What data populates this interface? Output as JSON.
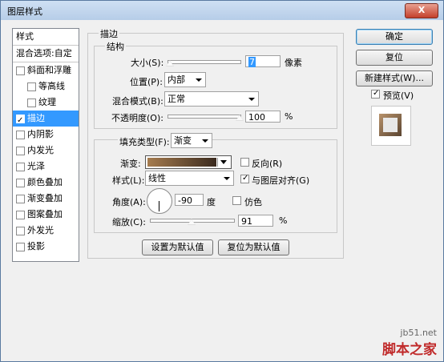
{
  "window": {
    "title": "图层样式",
    "close_glyph": "X"
  },
  "sidebar": {
    "header": "样式",
    "blend_options": "混合选项:自定",
    "items": [
      {
        "label": "斜面和浮雕",
        "checked": false
      },
      {
        "label": "等高线",
        "checked": false
      },
      {
        "label": "纹理",
        "checked": false
      },
      {
        "label": "描边",
        "checked": true,
        "selected": true
      },
      {
        "label": "内阴影",
        "checked": false
      },
      {
        "label": "内发光",
        "checked": false
      },
      {
        "label": "光泽",
        "checked": false
      },
      {
        "label": "颜色叠加",
        "checked": false
      },
      {
        "label": "渐变叠加",
        "checked": false
      },
      {
        "label": "图案叠加",
        "checked": false
      },
      {
        "label": "外发光",
        "checked": false
      },
      {
        "label": "投影",
        "checked": false
      }
    ]
  },
  "stroke": {
    "group_title": "描边",
    "structure": {
      "group_title": "结构",
      "size_label": "大小(S):",
      "size_value": "7",
      "size_unit": "像素",
      "size_slider": 0.03,
      "position_label": "位置(P):",
      "position_value": "内部",
      "blend_label": "混合模式(B):",
      "blend_value": "正常",
      "opacity_label": "不透明度(O):",
      "opacity_value": "100",
      "opacity_unit": "%",
      "opacity_slider": 1.0
    },
    "fill_type_label": "填充类型(F):",
    "fill_type_value": "渐变",
    "gradient_label": "渐变:",
    "reverse_label": "反向(R)",
    "reverse_checked": false,
    "style_label": "样式(L):",
    "style_value": "线性",
    "align_label": "与图层对齐(G)",
    "align_checked": true,
    "angle_label": "角度(A):",
    "angle_value": "-90",
    "angle_unit": "度",
    "dither_label": "仿色",
    "dither_checked": false,
    "scale_label": "缩放(C):",
    "scale_value": "91",
    "scale_unit": "%",
    "scale_slider": 0.5,
    "make_default": "设置为默认值",
    "reset_default": "复位为默认值"
  },
  "buttons": {
    "ok": "确定",
    "reset": "复位",
    "new_style": "新建样式(W)...",
    "preview_label": "预览(V)",
    "preview_checked": true
  },
  "watermark": {
    "line1": "jb51.net",
    "line2": "脚本之家"
  },
  "colors": {
    "selection": "#3399ff",
    "gradient_start": "#a67c4f",
    "gradient_end": "#3a2a1e"
  }
}
